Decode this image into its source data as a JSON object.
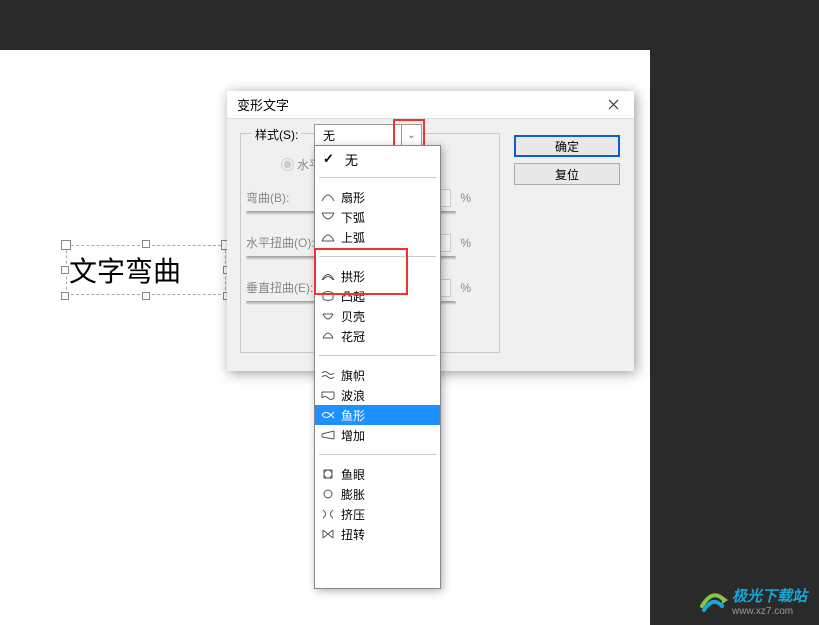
{
  "text_layer": "文字弯曲",
  "dialog": {
    "title": "变形文字",
    "style_label": "样式(S):",
    "style_value": "无",
    "orient_h": "水平",
    "sliders": {
      "bend": {
        "label": "弯曲(B):",
        "pct": "%"
      },
      "hdist": {
        "label": "水平扭曲(O):",
        "pct": "%"
      },
      "vdist": {
        "label": "垂直扭曲(E):",
        "pct": "%"
      }
    },
    "ok": "确定",
    "reset": "复位"
  },
  "dropdown": {
    "none": "无",
    "g1": [
      "扇形",
      "下弧",
      "上弧"
    ],
    "g2": [
      "拱形",
      "凸起",
      "贝壳",
      "花冠"
    ],
    "g3": [
      "旗帜",
      "波浪",
      "鱼形",
      "增加"
    ],
    "g4": [
      "鱼眼",
      "膨胀",
      "挤压",
      "扭转"
    ]
  },
  "watermark": {
    "title": "极光下载站",
    "url": "www.xz7.com"
  }
}
